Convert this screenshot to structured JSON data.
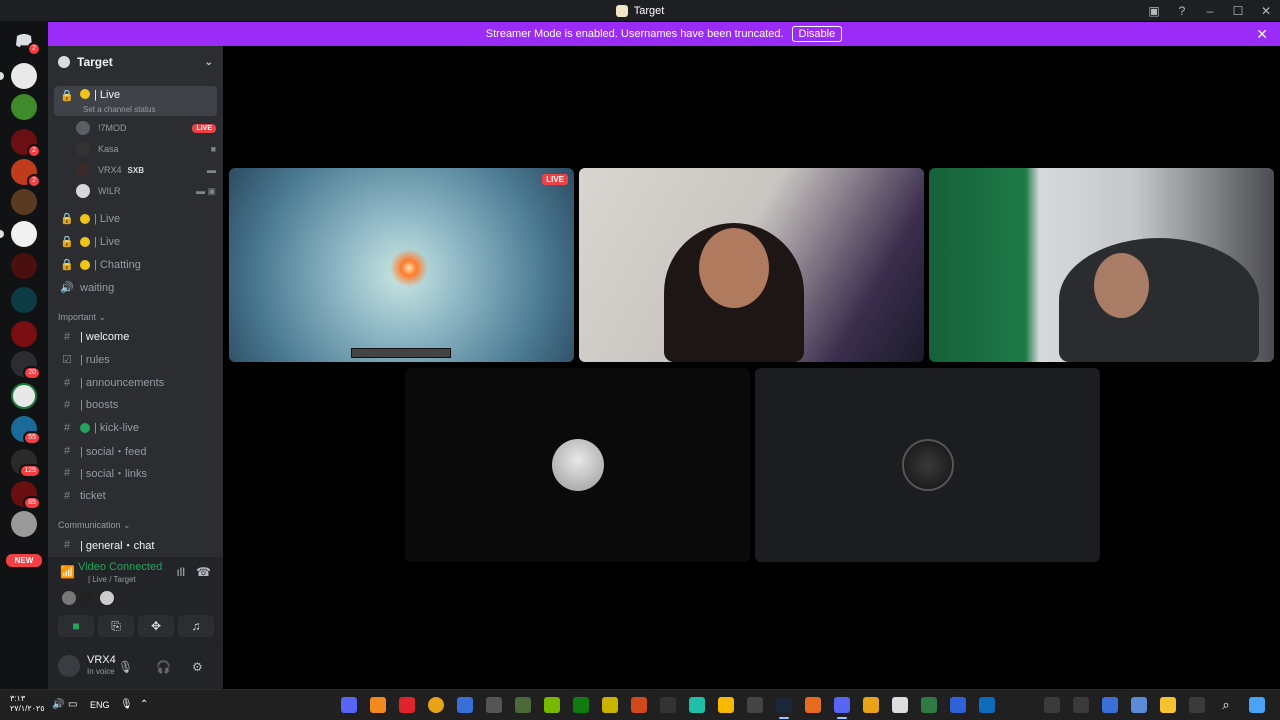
{
  "window": {
    "title": "Target",
    "controls": [
      "▣",
      "?",
      "–",
      "☐",
      "✕"
    ]
  },
  "banner": {
    "text": "Streamer Mode is enabled. Usernames have been truncated.",
    "button": "Disable",
    "close": "✕"
  },
  "rail": {
    "badges": [
      "2",
      "2",
      "2",
      "20",
      "55",
      "125",
      "85"
    ],
    "new_label": "NEW"
  },
  "guild": {
    "name": "Target",
    "chevron": "⌄"
  },
  "channels": {
    "live_selected": {
      "name": "| Live",
      "status": "Set a channel status"
    },
    "voice_users": [
      {
        "name": "!7MOD",
        "live": "LIVE"
      },
      {
        "name": "Kasa"
      },
      {
        "name": "VRX4",
        "tag": "SXB"
      },
      {
        "name": "WILR"
      }
    ],
    "locked": [
      "| Live",
      "| Live",
      "| Chatting"
    ],
    "waiting": "waiting",
    "important_label": "Important",
    "text": [
      "| welcome",
      "| rules",
      "| announcements",
      "| boosts",
      "| kick-live",
      "| social・feed",
      "| social・links",
      "ticket"
    ],
    "communication_label": "Communication",
    "general": "| general・chat"
  },
  "voice_panel": {
    "status": "Video Connected",
    "sub": "| Live / Target"
  },
  "user_panel": {
    "name": "VRX4",
    "status": "In voice"
  },
  "stage": {
    "live_badge": "LIVE"
  },
  "taskbar": {
    "time": "٣:١٣",
    "date": "٢٧/١/٢٠٢٥",
    "lang": "ENG"
  },
  "colors": {
    "banner": "#9b2cf8",
    "sidebar": "#2b2d31",
    "rail": "#111214",
    "live": "#ed4245",
    "connected": "#23a55a"
  }
}
